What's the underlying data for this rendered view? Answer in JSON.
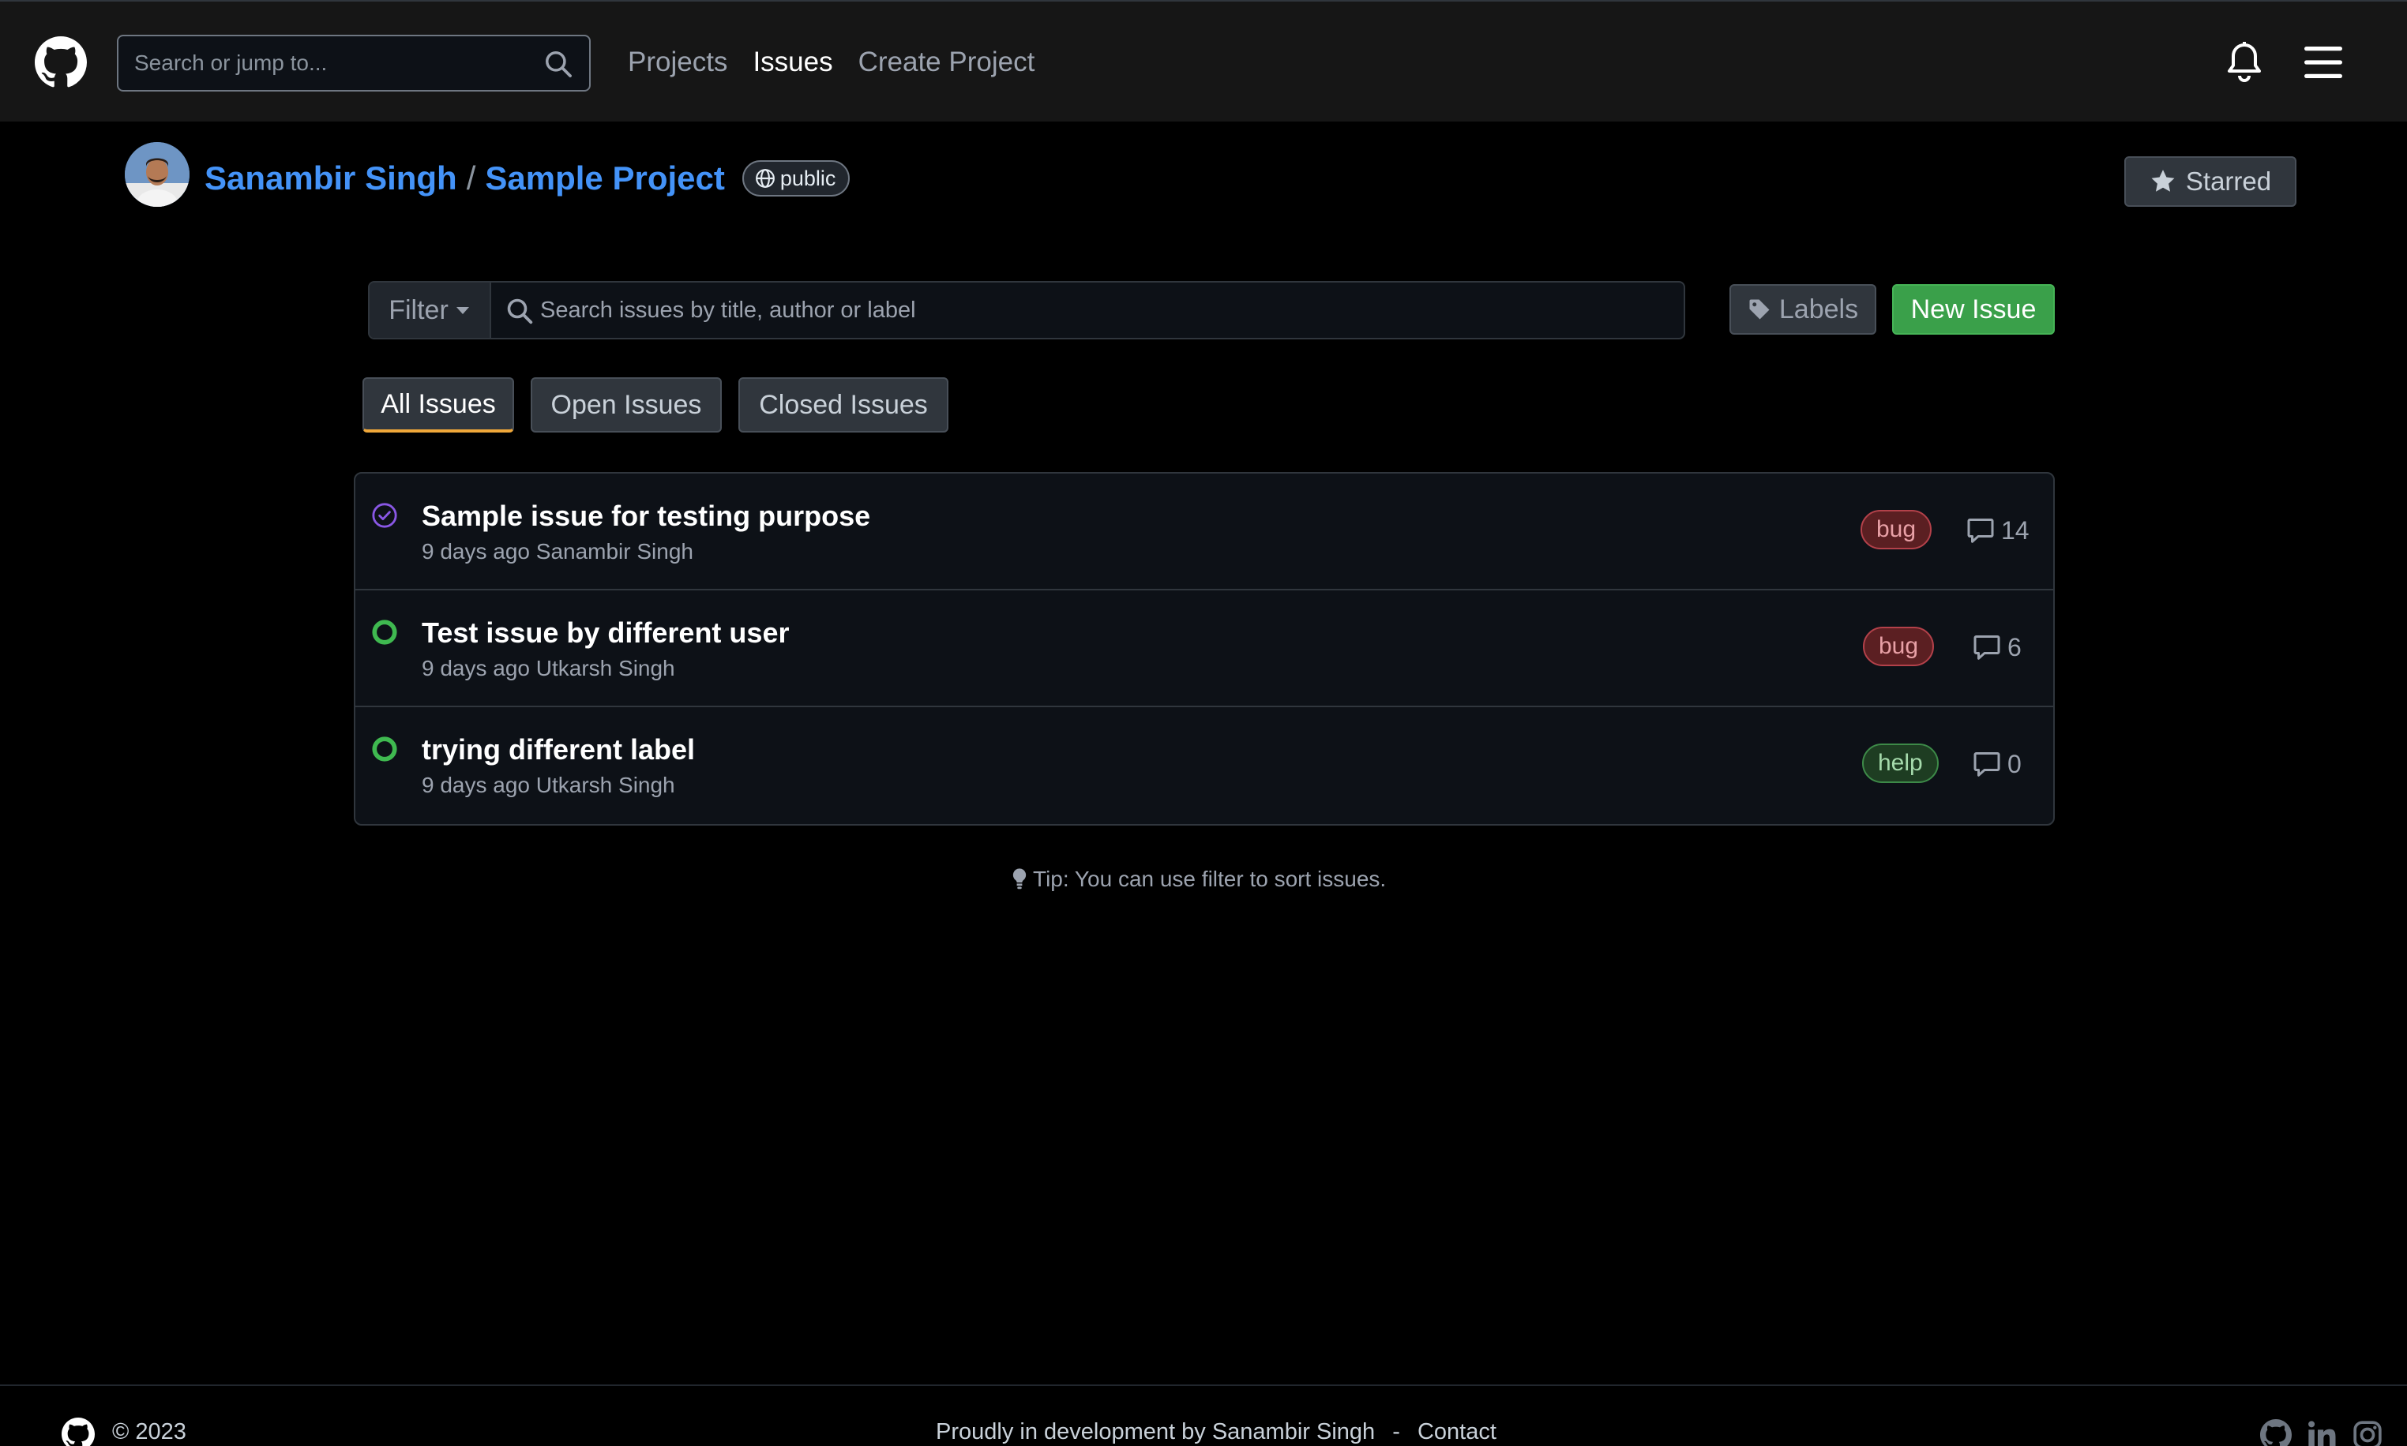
{
  "nav": {
    "search_placeholder": "Search or jump to...",
    "links": [
      "Projects",
      "Issues",
      "Create Project"
    ],
    "active_link": "Issues"
  },
  "repo": {
    "owner": "Sanambir Singh",
    "separator": "/",
    "name": "Sample Project",
    "visibility": "public",
    "star_label": "Starred"
  },
  "toolbar": {
    "filter_label": "Filter",
    "search_placeholder": "Search issues by title, author or label",
    "labels_label": "Labels",
    "new_issue_label": "New Issue"
  },
  "tabs": [
    "All Issues",
    "Open Issues",
    "Closed Issues"
  ],
  "active_tab": "All Issues",
  "issues": [
    {
      "title": "Sample issue for testing purpose",
      "meta": "9 days ago Sanambir Singh",
      "state": "closed",
      "label": "bug",
      "comments": "14"
    },
    {
      "title": "Test issue by different user",
      "meta": "9 days ago Utkarsh Singh",
      "state": "open",
      "label": "bug",
      "comments": "6"
    },
    {
      "title": "trying different label",
      "meta": "9 days ago Utkarsh Singh",
      "state": "open",
      "label": "help",
      "comments": "0"
    }
  ],
  "tip": "Tip: You can use filter to sort issues.",
  "footer": {
    "copyright": "© 2023",
    "credit": "Proudly in development by Sanambir Singh",
    "separator": "-",
    "contact": "Contact"
  },
  "colors": {
    "accent_link": "#4493f8",
    "new_issue_green": "#3aa04a",
    "open_state": "#3fb950",
    "closed_state": "#8957e5",
    "active_tab_underline": "#f0a83a"
  }
}
